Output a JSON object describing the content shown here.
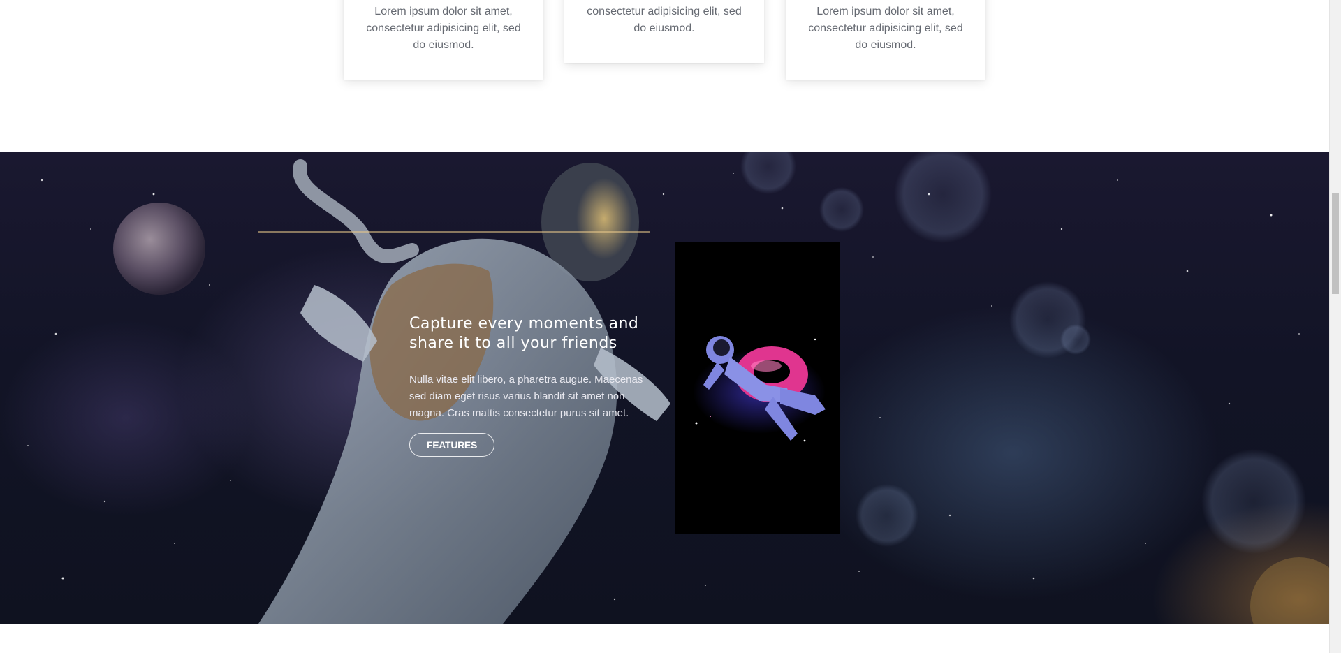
{
  "cards": [
    {
      "text": "Lorem ipsum dolor sit amet, consectetur adipisicing elit, sed do eiusmod."
    },
    {
      "text": "consectetur adipisicing elit, sed do eiusmod."
    },
    {
      "text": "Lorem ipsum dolor sit amet, consectetur adipisicing elit, sed do eiusmod."
    }
  ],
  "hero": {
    "title": "Capture every moments and share it to all your friends",
    "body": "Nulla vitae elit libero, a pharetra augue. Maecenas sed diam eget risus varius blandit sit amet non magna. Cras mattis consectetur purus sit amet.",
    "button_label": "FEATURES"
  },
  "icons": {
    "video_panel": "astronaut-floating-icon"
  },
  "colors": {
    "hero_background": "#141528",
    "panel_background": "#000000",
    "float_ring": "#e0358f",
    "astronaut_suit": "#7f86e0"
  }
}
